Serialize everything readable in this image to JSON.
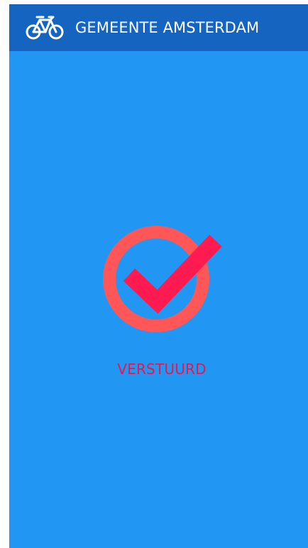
{
  "colors": {
    "app_bar": "#1565c0",
    "background": "#2196f3",
    "ring": "#ff5757",
    "checkmark": "#ff1a4f",
    "status_text": "#e8174f",
    "icon": "#ffffff"
  },
  "app_bar": {
    "icon": "bicycle-icon",
    "title": "GEMEENTE AMSTERDAM"
  },
  "content": {
    "icon": "check-circle-icon",
    "status": "VERSTUURD"
  }
}
